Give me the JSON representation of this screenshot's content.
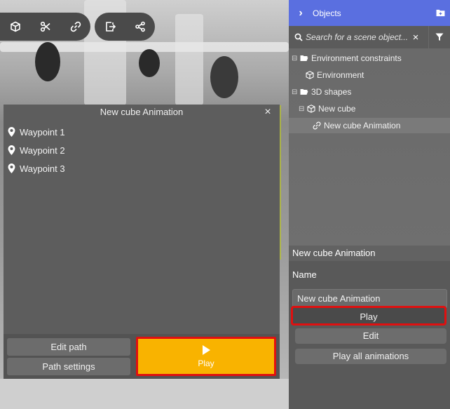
{
  "toolbar": {
    "group1": [
      "cube-icon",
      "scissors-icon",
      "link-icon"
    ],
    "group2": [
      "export-icon",
      "share-icon"
    ]
  },
  "animation_panel": {
    "title": "New cube Animation",
    "close": "×",
    "waypoints": [
      "Waypoint 1",
      "Waypoint 2",
      "Waypoint 3"
    ],
    "edit_path": "Edit path",
    "path_settings": "Path settings",
    "play": "Play",
    "play_color": "#f9b300"
  },
  "objects_panel": {
    "title": "Objects",
    "accent": "#5a6fe0",
    "search_placeholder": "Search for a scene object...",
    "tree": {
      "env_constraints": "Environment constraints",
      "environment": "Environment",
      "shapes": "3D shapes",
      "cube": "New cube",
      "animation": "New cube Animation"
    }
  },
  "properties": {
    "title": "New cube Animation",
    "name_label": "Name",
    "name_value": "New cube Animation",
    "play": "Play",
    "edit": "Edit",
    "play_all": "Play all animations"
  }
}
